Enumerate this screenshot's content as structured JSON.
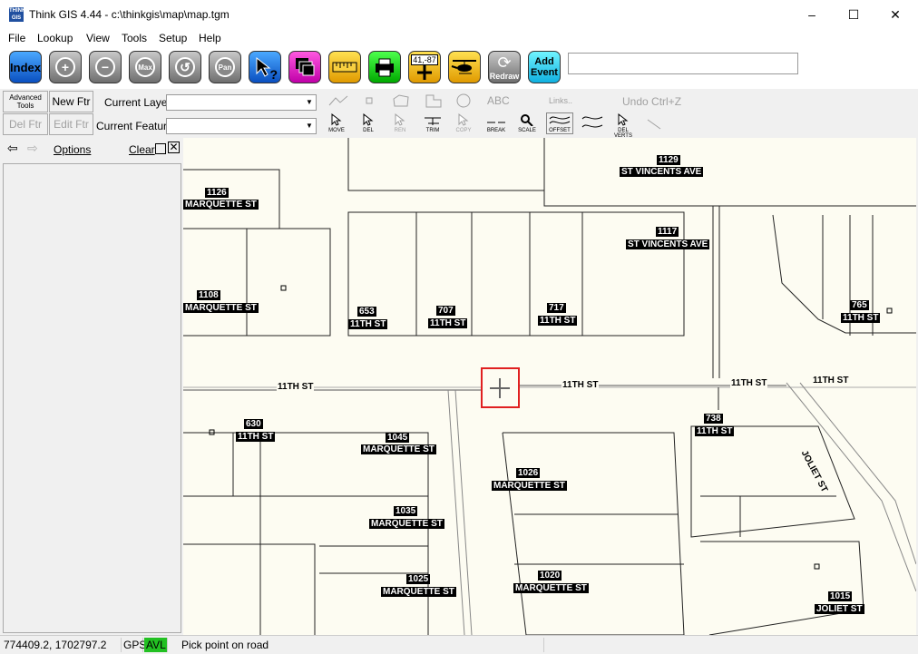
{
  "window": {
    "title": "Think GIS 4.44 - c:\\thinkgis\\map\\map.tgm",
    "minimize": "–",
    "maximize": "☐",
    "close": "✕"
  },
  "app_icon": "THINK GIS",
  "menu": [
    "File",
    "Lookup",
    "View",
    "Tools",
    "Setup",
    "Help"
  ],
  "toolbar": {
    "index": "Index",
    "zoom_in": "+",
    "zoom_out": "−",
    "max": "Max",
    "previous": "↺",
    "pan": "Pan",
    "identify": "?",
    "gps_coords": "41,-87",
    "redraw": "Redraw",
    "add_event_line1": "Add",
    "add_event_line2": "Event",
    "event_value": ""
  },
  "edit": {
    "advanced_tools_line1": "Advanced",
    "advanced_tools_line2": "Tools",
    "new_ftr": "New Ftr",
    "del_ftr": "Del Ftr",
    "edit_ftr": "Edit Ftr",
    "current_layer_label": "Current Layer",
    "current_layer_value": "",
    "current_feature_label": "Current Feature",
    "current_feature_value": "",
    "abc": "ABC",
    "links": "Links..",
    "undo": "Undo Ctrl+Z",
    "tools": [
      "MOVE",
      "DEL",
      "REN",
      "TRIM",
      "COPY",
      "BREAK",
      "SCALE",
      "OFFSET",
      "",
      "DEL VERTS"
    ]
  },
  "panel": {
    "options": "Options",
    "clear": "Clear"
  },
  "map": {
    "labels": [
      {
        "num": "1129",
        "street": "ST VINCENTS AVE"
      },
      {
        "num": "1126",
        "street": "MARQUETTE ST"
      },
      {
        "num": "1117",
        "street": "ST VINCENTS AVE"
      },
      {
        "num": "1108",
        "street": "MARQUETTE ST"
      },
      {
        "num": "653",
        "street": "11TH ST"
      },
      {
        "num": "707",
        "street": "11TH ST"
      },
      {
        "num": "717",
        "street": "11TH ST"
      },
      {
        "num": "765",
        "street": "11TH ST"
      },
      {
        "num": "630",
        "street": "11TH ST"
      },
      {
        "num": "1045",
        "street": "MARQUETTE ST"
      },
      {
        "num": "738",
        "street": "11TH ST"
      },
      {
        "num": "1026",
        "street": "MARQUETTE ST"
      },
      {
        "num": "1035",
        "street": "MARQUETTE ST"
      },
      {
        "num": "1025",
        "street": "MARQUETTE ST"
      },
      {
        "num": "1020",
        "street": "MARQUETTE ST"
      },
      {
        "num": "1015",
        "street": "JOLIET ST"
      }
    ],
    "road_labels": [
      "11TH ST",
      "11TH ST",
      "11TH ST",
      "11TH ST",
      "JOLIET ST"
    ]
  },
  "status": {
    "coords": "774409.2, 1702797.2",
    "gps": "GPS",
    "avl": "AVL",
    "message": "Pick point on road"
  },
  "colors": {
    "avl": "#22c022",
    "selection": "#e02020"
  }
}
